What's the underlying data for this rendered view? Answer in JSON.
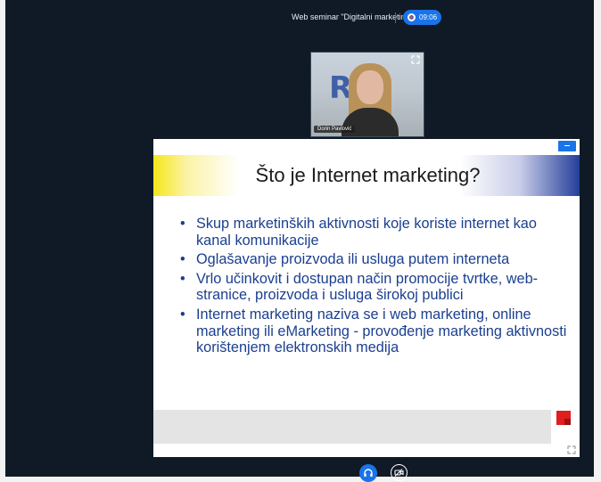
{
  "header": {
    "session_title": "Web seminar \"Digitalni marketing\"",
    "recording_time": "09:06",
    "recording_color": "#1a73e8"
  },
  "video": {
    "participant_name": "Dorin Pavlović"
  },
  "slide": {
    "title": "Što je Internet marketing?",
    "bullets": [
      "Skup marketinških aktivnosti koje koriste internet kao kanal komunikacije",
      "Oglašavanje proizvoda ili usluga putem interneta",
      "Vrlo učinkovit i dostupan način promocije tvrtke, web-stranice, proizvoda i usluga širokoj publici",
      "Internet marketing naziva se i web marketing, online marketing ili eMarketing - provođenje marketing aktivnosti korištenjem elektronskih medija"
    ],
    "text_color": "#1b3f8f"
  },
  "controls": {
    "audio_icon": "headset-icon",
    "camera_icon": "camera-off-icon",
    "expand_icon": "expand-icon",
    "fullscreen_icon": "fullscreen-icon"
  }
}
